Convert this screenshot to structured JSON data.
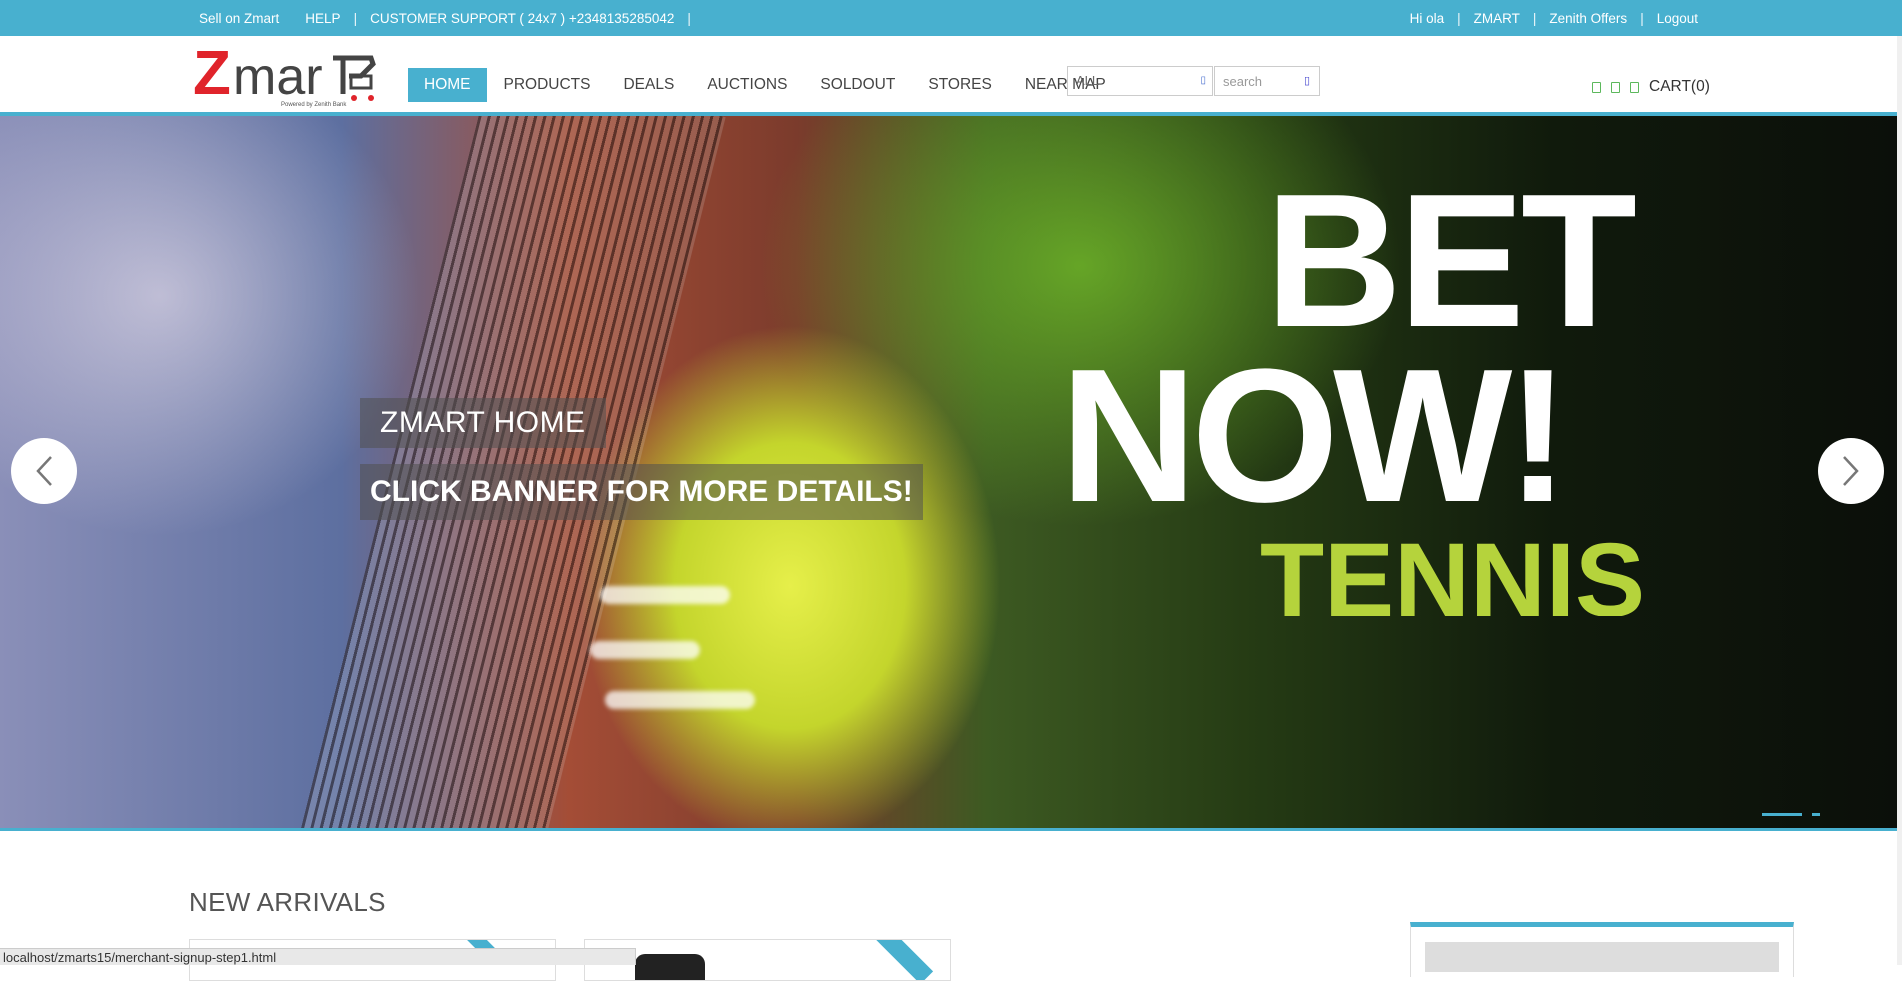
{
  "topbar": {
    "left_links": [
      "Sell on Zmart",
      "HELP",
      "CUSTOMER SUPPORT ( 24x7 ) +2348135285042"
    ],
    "right_links": [
      "Hi ola",
      "ZMART",
      "Zenith Offers",
      "Logout"
    ],
    "separator": "|"
  },
  "logo": {
    "text": "Zmart",
    "tagline": "Powered by Zenith Bank"
  },
  "nav": {
    "items": [
      "HOME",
      "PRODUCTS",
      "DEALS",
      "AUCTIONS",
      "SOLDOUT",
      "STORES",
      "NEAR MAP"
    ],
    "active": "HOME"
  },
  "search": {
    "category_selected": "ALL",
    "placeholder": "search"
  },
  "cart": {
    "label": "CART(0)"
  },
  "banner": {
    "title": "ZMART HOME",
    "subtitle": "CLICK BANNER FOR MORE DETAILS!",
    "art_text": [
      "BET",
      "NOW!",
      "TENNIS"
    ],
    "slide_count": 2,
    "active_slide": 1
  },
  "sections": {
    "new_arrivals": "NEW ARRIVALS"
  },
  "status_bar": {
    "url": "localhost/zmarts15/merchant-signup-step1.html"
  },
  "colors": {
    "accent": "#48b0cf",
    "logo_red": "#e0242b",
    "tennis_green": "#b5d33c"
  },
  "icons": [
    "chevron-left-icon",
    "chevron-right-icon",
    "search-icon",
    "dropdown-icon",
    "cart-icon"
  ]
}
